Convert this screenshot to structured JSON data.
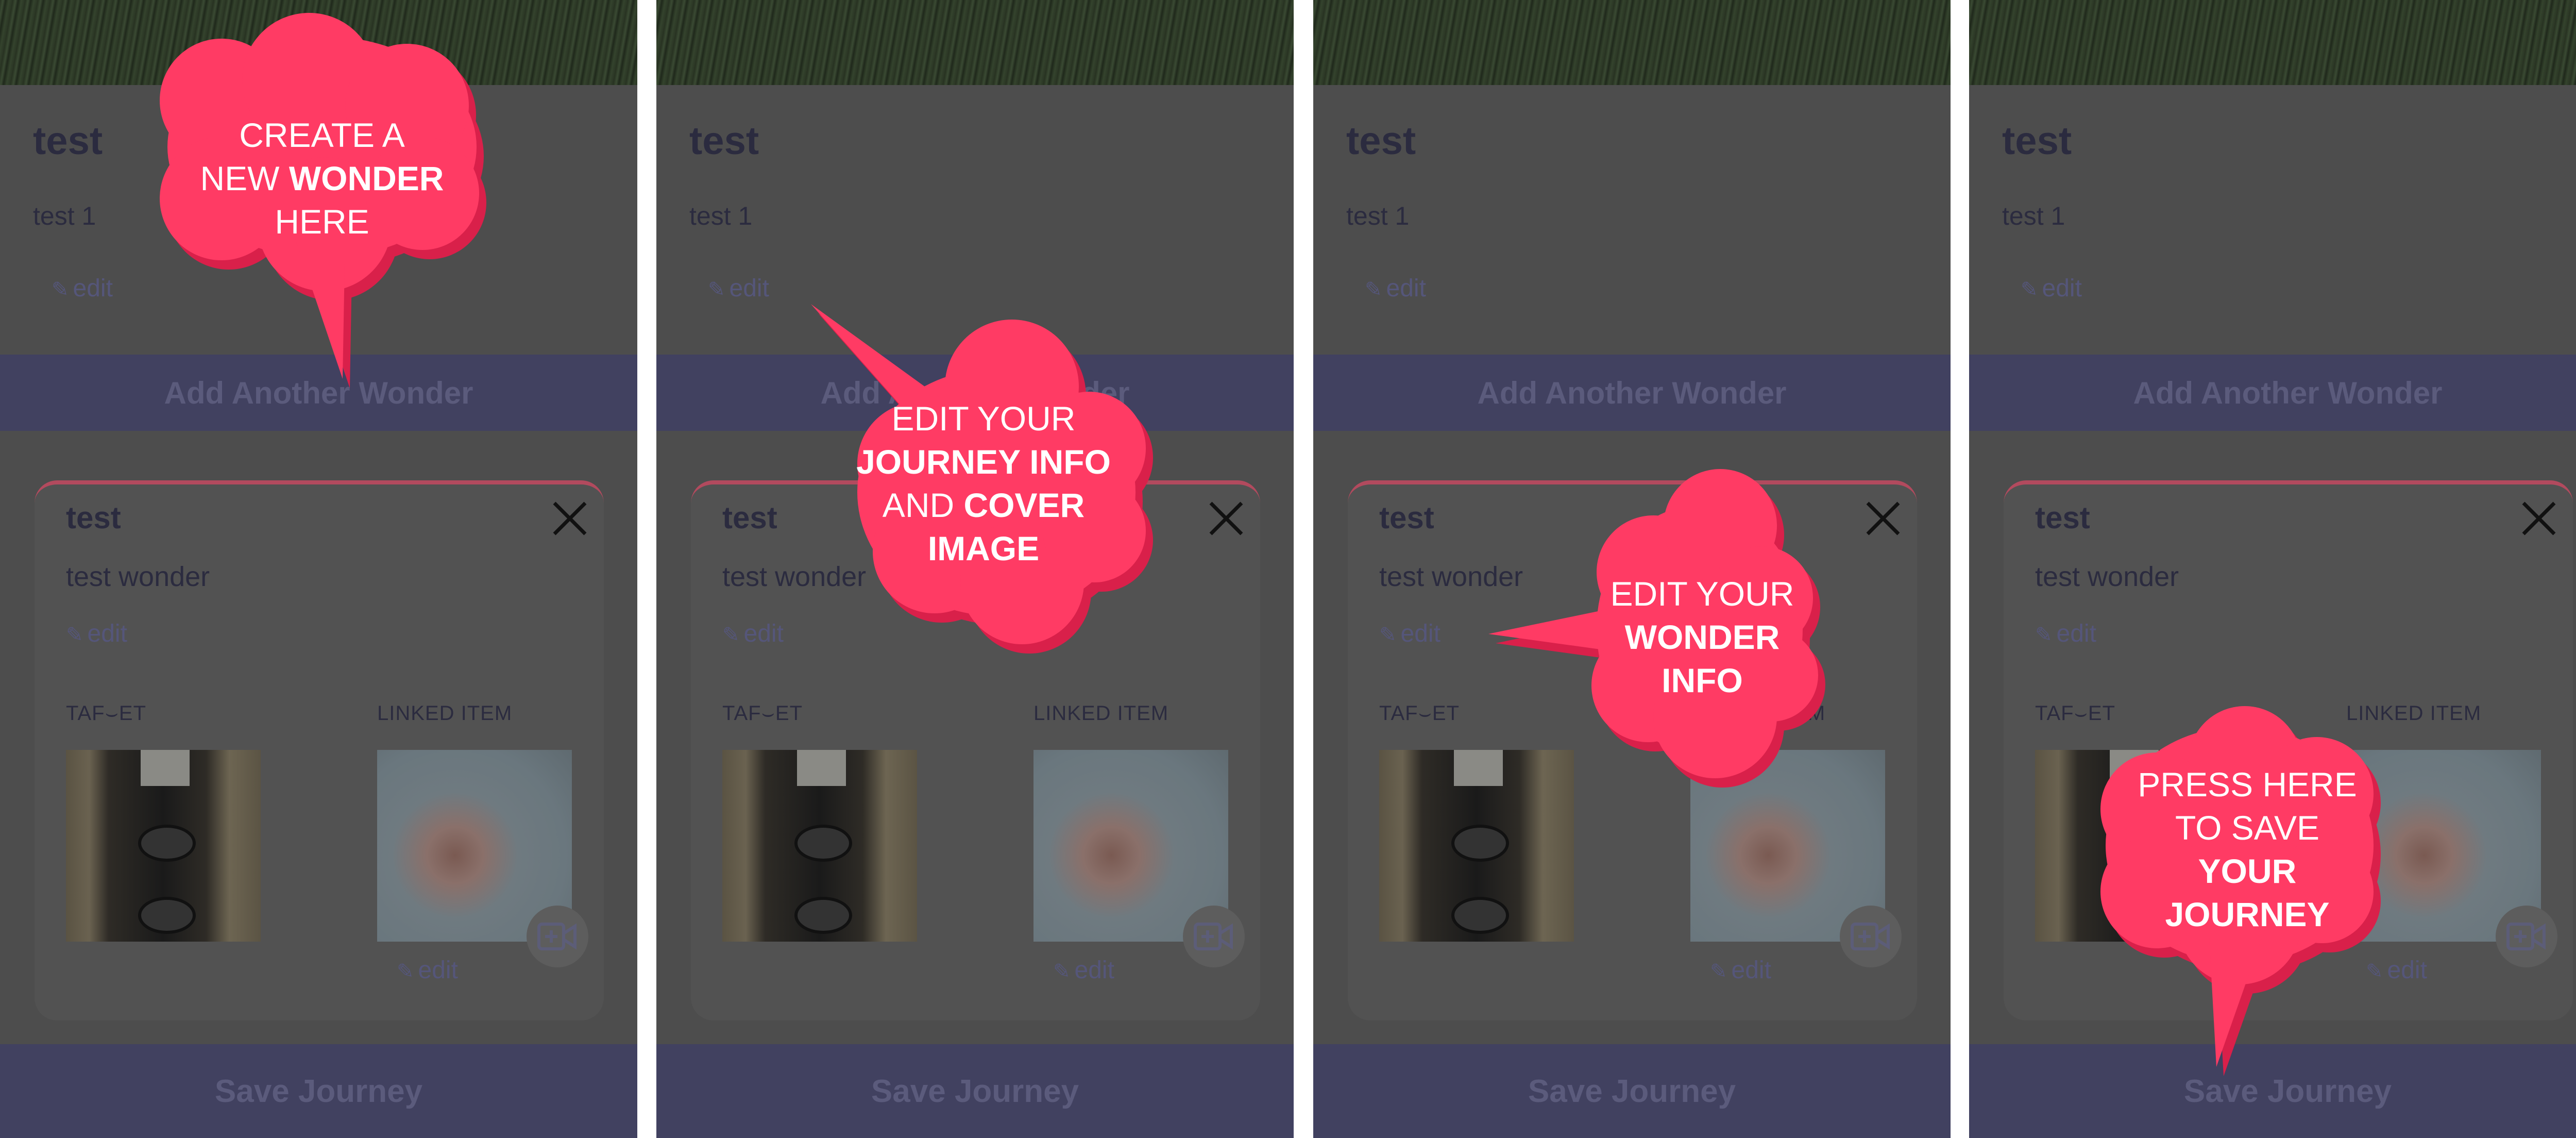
{
  "colors": {
    "accent": "#ff3b64",
    "accent_shadow": "#d9204a",
    "bar": "#414160",
    "overlay_text": "#2b2b3f"
  },
  "screen": {
    "journey_title": "test",
    "journey_description": "test 1",
    "edit_label": "edit",
    "add_button_label": "Add Another Wonder",
    "wonder_title": "test",
    "wonder_description": "test wonder",
    "target_label": "TAF⌣ET",
    "linked_label": "LINKED ITEM",
    "save_button_label": "Save Journey"
  },
  "callouts": [
    {
      "normal_1": "CREATE A",
      "normal_2": "NEW ",
      "bold_2": "WONDER",
      "normal_3": "HERE"
    },
    {
      "line_1": "EDIT YOUR",
      "line_2": "JOURNEY INFO",
      "line_3_normal": "AND ",
      "line_3_bold": "COVER",
      "line_4": "IMAGE"
    },
    {
      "line_1": "EDIT YOUR",
      "line_2": "WONDER",
      "line_3": "INFO"
    },
    {
      "line_1": "PRESS HERE",
      "line_2": "TO SAVE",
      "line_3": "YOUR",
      "line_4": "JOURNEY"
    }
  ]
}
